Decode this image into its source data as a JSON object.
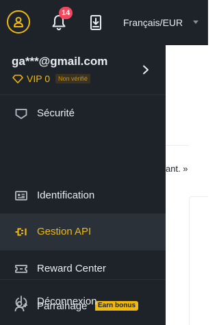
{
  "header": {
    "notification_count": "14",
    "language_currency": "Français/EUR"
  },
  "page": {
    "partial_text": "ant. »"
  },
  "account": {
    "email": "ga***@gmail.com",
    "vip_level": "VIP 0",
    "verification_status": "Non vérifié"
  },
  "menu": {
    "items": [
      {
        "label": "Sécurité",
        "icon": "monitor-shield-icon"
      },
      {
        "label": "Identification",
        "icon": "id-card-icon"
      },
      {
        "label": "Gestion API",
        "icon": "api-key-icon",
        "active": true
      },
      {
        "label": "Reward Center",
        "icon": "ticket-icon"
      },
      {
        "label": "Parrainage",
        "icon": "add-user-icon",
        "badge": "Earn bonus"
      },
      {
        "label": "Déconnexion",
        "icon": "power-icon"
      }
    ]
  },
  "colors": {
    "background_dark": "#1e2329",
    "active_row": "#2b3139",
    "accent": "#f0b90b",
    "badge_red": "#f6465d",
    "text_primary": "#eaecef",
    "text_secondary": "#848e9c"
  }
}
